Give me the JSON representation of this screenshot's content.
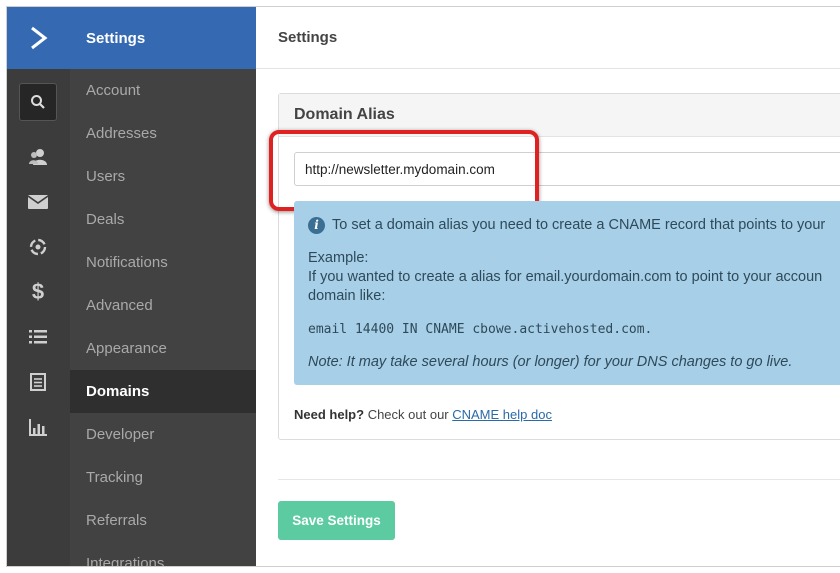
{
  "nav": {
    "header": "Settings",
    "items": [
      {
        "label": "Account"
      },
      {
        "label": "Addresses"
      },
      {
        "label": "Users"
      },
      {
        "label": "Deals"
      },
      {
        "label": "Notifications"
      },
      {
        "label": "Advanced"
      },
      {
        "label": "Appearance"
      },
      {
        "label": "Domains",
        "active": true
      },
      {
        "label": "Developer"
      },
      {
        "label": "Tracking"
      },
      {
        "label": "Referrals"
      },
      {
        "label": "Integrations"
      }
    ]
  },
  "rail": {
    "icons": [
      "logo-chevron-icon",
      "search-icon",
      "contacts-icon",
      "mail-icon",
      "automations-icon",
      "dollar-icon",
      "list-icon",
      "forms-icon",
      "reports-icon"
    ]
  },
  "main": {
    "title": "Settings",
    "panel": {
      "title": "Domain Alias",
      "domain_value": "http://newsletter.mydomain.com",
      "info": {
        "line1": "To set a domain alias you need to create a CNAME record that points to your",
        "example_label": "Example:",
        "example_text1": "If you wanted to create a alias for email.yourdomain.com to point to your accoun",
        "example_text2": "domain like:",
        "code": "email 14400 IN CNAME cbowe.activehosted.com.",
        "note": "Note: It may take several hours (or longer) for your DNS changes to go live."
      },
      "help": {
        "bold": "Need help?",
        "text": " Check out our ",
        "link": "CNAME help doc"
      }
    },
    "save_label": "Save Settings"
  },
  "colors": {
    "brand_blue": "#356ab3",
    "sidebar_dark": "#3c3c3c",
    "info_blue": "#a7cfe7",
    "save_green": "#5ccba1",
    "highlight_red": "#e02121"
  }
}
